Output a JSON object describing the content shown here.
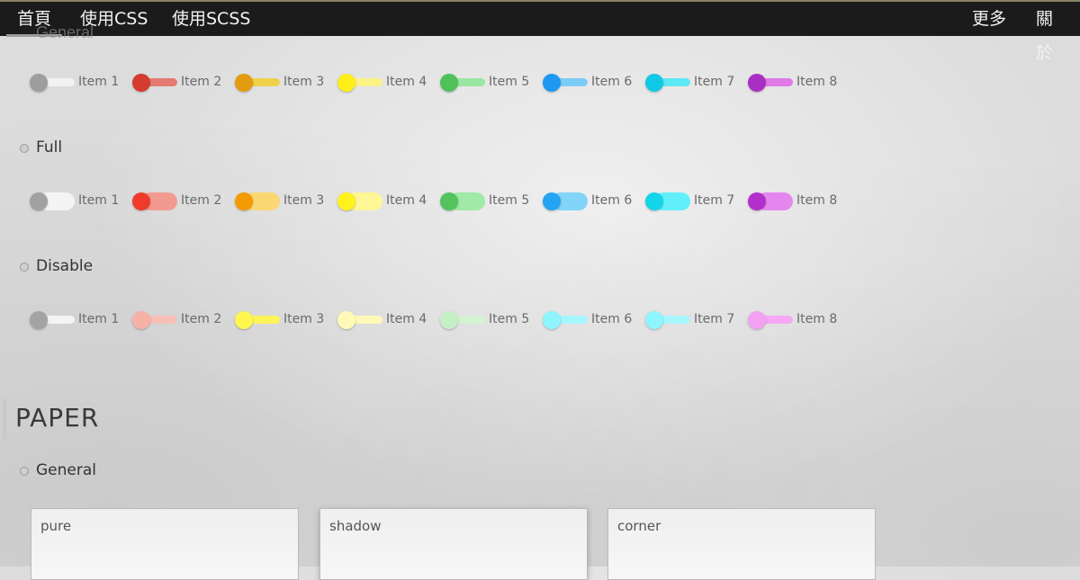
{
  "nav": {
    "left": [
      "首頁",
      "使用CSS",
      "使用SCSS"
    ],
    "right": [
      "更多",
      "關於"
    ]
  },
  "ghost_heading": "General",
  "rows": {
    "general": {
      "items": [
        "Item 1",
        "Item 2",
        "Item 3",
        "Item 4",
        "Item 5",
        "Item 6",
        "Item 7",
        "Item 8"
      ],
      "knob_colors": [
        "#9e9e9e",
        "#d53b2f",
        "#e39b0f",
        "#ffee1a",
        "#4ec15a",
        "#1e98f2",
        "#11c9e4",
        "#a92fc4"
      ],
      "track_colors": [
        "#f2f2f2",
        "#e57a72",
        "#efd04a",
        "#fbf383",
        "#9ae6a2",
        "#7ccbf5",
        "#5ce8f5",
        "#e07be7"
      ]
    },
    "full": {
      "heading": "Full",
      "items": [
        "Item 1",
        "Item 2",
        "Item 3",
        "Item 4",
        "Item 5",
        "Item 6",
        "Item 7",
        "Item 8"
      ],
      "knob_colors": [
        "#a1a1a1",
        "#ee3b2c",
        "#f39a05",
        "#fff21d",
        "#53c45d",
        "#24a4f2",
        "#13d5e8",
        "#b22fcc"
      ],
      "track_colors": [
        "#f4f4f4",
        "#f29a90",
        "#fbd773",
        "#fff695",
        "#a0e9a6",
        "#82d4f8",
        "#61f0fa",
        "#e387ee"
      ]
    },
    "disable": {
      "heading": "Disable",
      "items": [
        "Item 1",
        "Item 2",
        "Item 3",
        "Item 4",
        "Item 5",
        "Item 6",
        "Item 7",
        "Item 8"
      ],
      "knob_colors": [
        "#a3a3a3",
        "#f6b2a6",
        "#fff64e",
        "#fff9b5",
        "#c5f0c6",
        "#8ef5ff",
        "#8ef5ff",
        "#f5a1f3"
      ],
      "track_colors": [
        "#f4f4f4",
        "#f7c0b6",
        "#fff35a",
        "#fff9b8",
        "#d3f3d3",
        "#a7f6ff",
        "#a7f6ff",
        "#f7a7f7"
      ]
    }
  },
  "section": {
    "title": "PAPER",
    "general_heading": "General",
    "cards": [
      "pure",
      "shadow",
      "corner"
    ]
  }
}
